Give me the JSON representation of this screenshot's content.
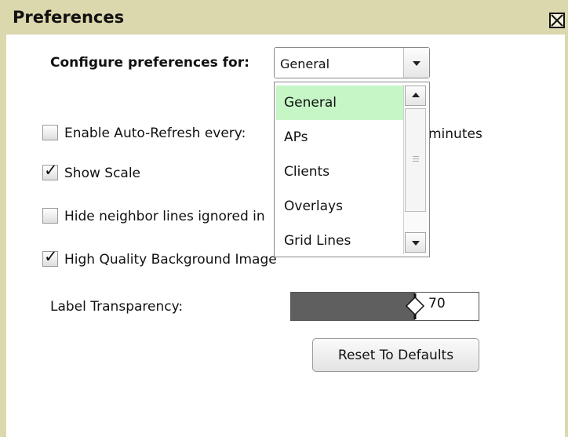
{
  "dialog": {
    "title": "Preferences",
    "close_icon": "close-box-icon"
  },
  "configure": {
    "label": "Configure preferences for:",
    "selected": "General",
    "options": [
      "General",
      "APs",
      "Clients",
      "Overlays",
      "Grid Lines"
    ]
  },
  "options": {
    "auto_refresh_label": "Enable Auto-Refresh every:",
    "auto_refresh_checked": false,
    "auto_refresh_unit": "minutes",
    "show_scale_label": "Show Scale",
    "show_scale_checked": true,
    "hide_neighbor_label": "Hide neighbor lines ignored in",
    "hide_neighbor_checked": false,
    "hq_background_label": "High Quality Background Image",
    "hq_background_checked": true
  },
  "label_transparency": {
    "label": "Label Transparency:",
    "value": 70,
    "display": "70"
  },
  "actions": {
    "reset_label": "Reset To Defaults"
  },
  "colors": {
    "titlebar": "#dcd8ad",
    "selected_option": "#c6f6c6",
    "slider_fill": "#5f5f5f"
  }
}
